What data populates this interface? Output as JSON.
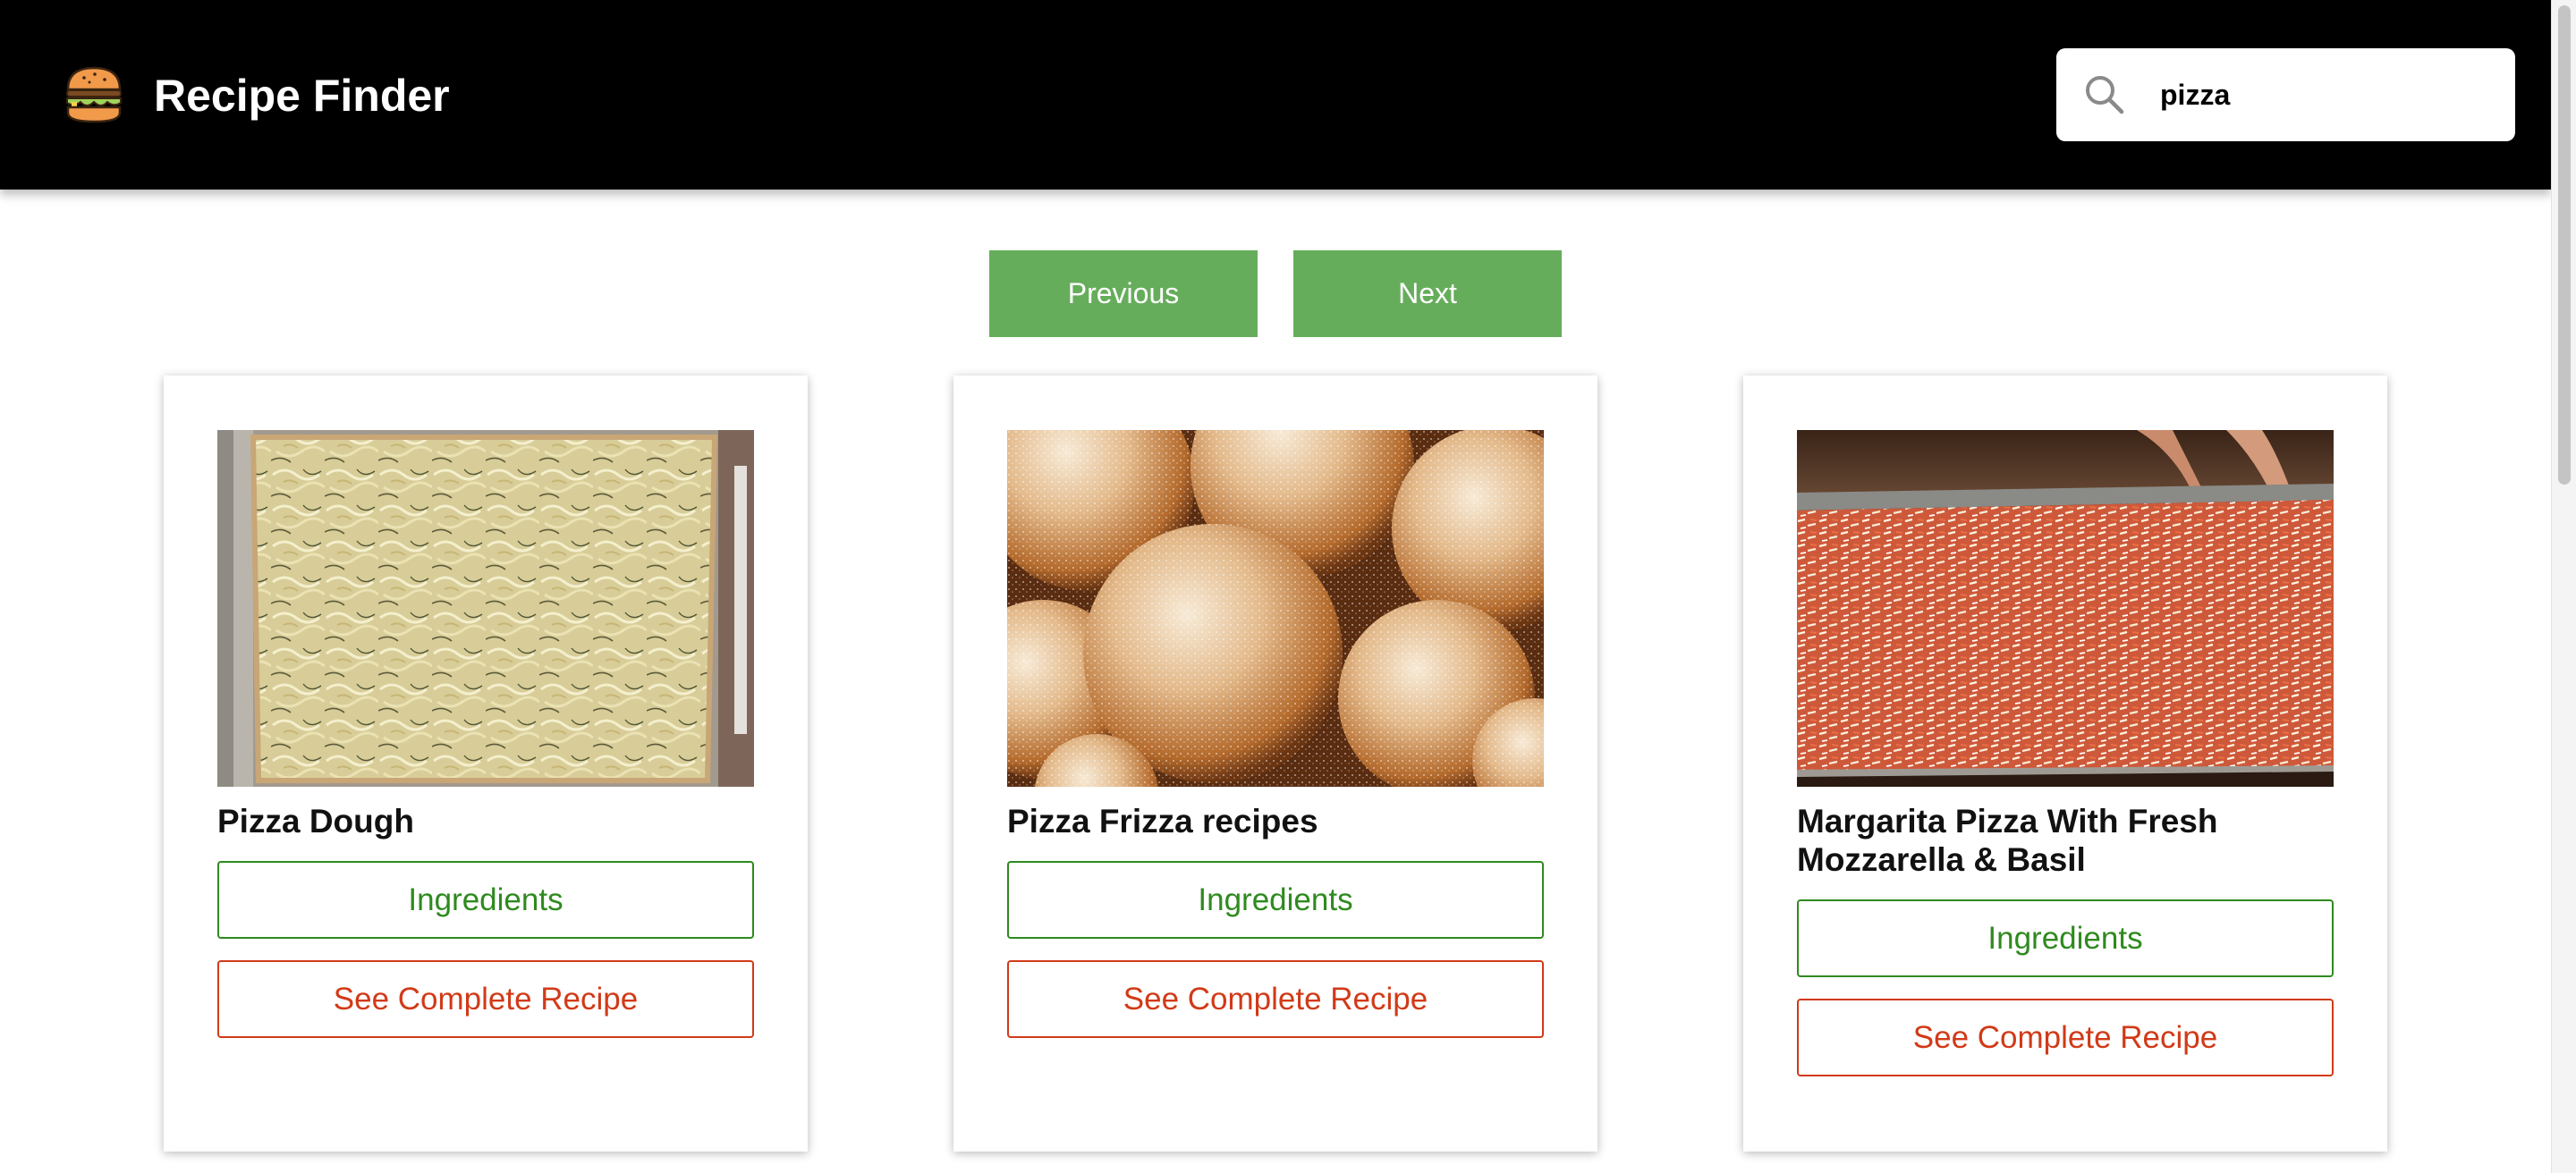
{
  "header": {
    "title": "Recipe Finder",
    "logo_icon": "burger-icon",
    "background_color": "#000000"
  },
  "search": {
    "icon": "search-icon",
    "value": "pizza",
    "placeholder": ""
  },
  "pagination": {
    "previous_label": "Previous",
    "next_label": "Next",
    "button_color": "#66ad5b"
  },
  "recipes": [
    {
      "title": "Pizza Dough",
      "image_description": "flatbread with onions",
      "ingredients_label": "Ingredients",
      "recipe_label": "See Complete Recipe"
    },
    {
      "title": "Pizza Frizza recipes",
      "image_description": "sugared dough balls",
      "ingredients_label": "Ingredients",
      "recipe_label": "See Complete Recipe"
    },
    {
      "title": "Margarita Pizza With Fresh Mozzarella & Basil",
      "image_description": "pizza with shredded cheese",
      "ingredients_label": "Ingredients",
      "recipe_label": "See Complete Recipe"
    }
  ],
  "colors": {
    "ingredients_accent": "#2f8a1f",
    "recipe_accent": "#d13a18"
  }
}
